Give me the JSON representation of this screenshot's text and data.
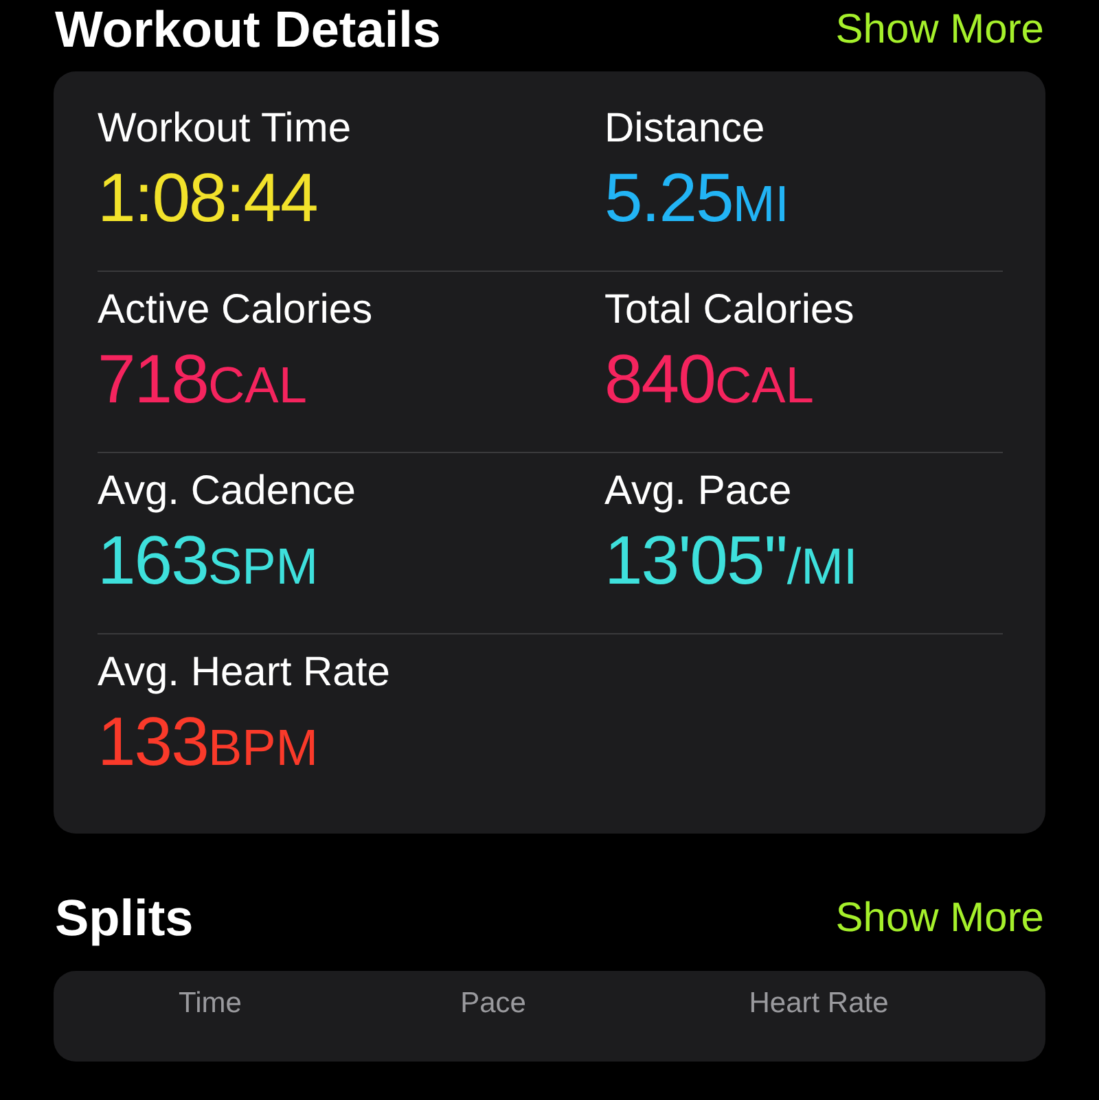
{
  "workout_details": {
    "title": "Workout Details",
    "action": "Show More",
    "metrics": [
      {
        "label": "Workout Time",
        "value": "1:08:44",
        "color": "#f2e22b"
      },
      {
        "label": "Distance",
        "value": "5.25",
        "unit": "MI",
        "color": "#22b4f5"
      },
      {
        "label": "Active Calories",
        "value": "718",
        "unit": "CAL",
        "color": "#f5245e"
      },
      {
        "label": "Total Calories",
        "value": "840",
        "unit": "CAL",
        "color": "#f5245e"
      },
      {
        "label": "Avg. Cadence",
        "value": "163",
        "unit": "SPM",
        "color": "#3ee0dc"
      },
      {
        "label": "Avg. Pace",
        "value": "13'05''",
        "unit": "/MI",
        "color": "#3ee0dc"
      },
      {
        "label": "Avg. Heart Rate",
        "value": "133",
        "unit": "BPM",
        "color": "#fa3a2a"
      }
    ]
  },
  "splits": {
    "title": "Splits",
    "action": "Show More",
    "columns": [
      "Time",
      "Pace",
      "Heart Rate"
    ]
  }
}
